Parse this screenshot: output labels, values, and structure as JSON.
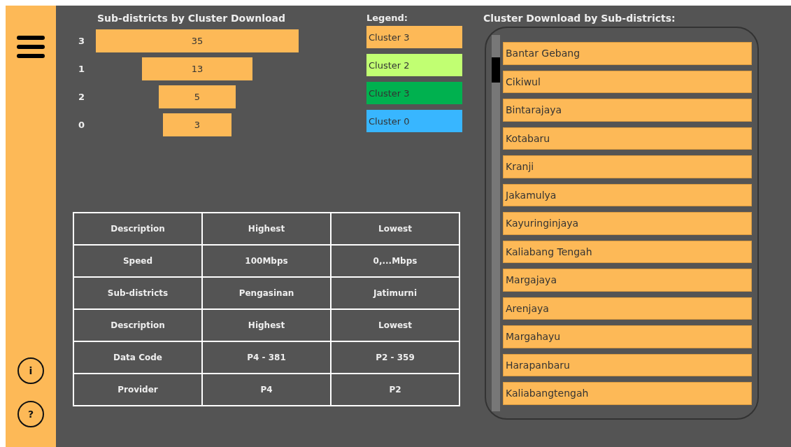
{
  "sidebar": {
    "buttons": [
      {
        "kind": "menu"
      },
      {
        "kind": "info",
        "label": "i"
      },
      {
        "kind": "help",
        "label": "?"
      }
    ]
  },
  "funnel": {
    "title": "Sub-districts by Cluster Download",
    "stages": [
      {
        "label": "3",
        "value": "35"
      },
      {
        "label": "1",
        "value": "13"
      },
      {
        "label": "2",
        "value": "5"
      },
      {
        "label": "0",
        "value": "3"
      }
    ]
  },
  "legend": {
    "title": "Legend:",
    "items": [
      {
        "label": "Cluster 3",
        "color": "#fdb957"
      },
      {
        "label": "Cluster 2",
        "color": "#c1ff72"
      },
      {
        "label": "Cluster 3",
        "color": "#00b14f"
      },
      {
        "label": "Cluster 0",
        "color": "#38b6ff"
      }
    ]
  },
  "table": {
    "rows": [
      [
        "Description",
        "Highest",
        "Lowest"
      ],
      [
        "Speed",
        "100Mbps",
        "0,...Mbps"
      ],
      [
        "Sub-districts",
        "Pengasinan",
        "Jatimurni"
      ],
      [
        "Description",
        "Highest",
        "Lowest"
      ],
      [
        "Data Code",
        "P4 - 381",
        "P2 - 359"
      ],
      [
        "Provider",
        "P4",
        "P2"
      ]
    ]
  },
  "subdistrict_list": {
    "title": "Cluster Download by Sub-districts:",
    "items": [
      "Bantar Gebang",
      "Cikiwul",
      "Bintarajaya",
      "Kotabaru",
      "Kranji",
      "Jakamulya",
      "Kayuringinjaya",
      "Kaliabang Tengah",
      "Margajaya",
      "Arenjaya",
      "Margahayu",
      "Harapanbaru",
      "Kaliabangtengah"
    ]
  }
}
